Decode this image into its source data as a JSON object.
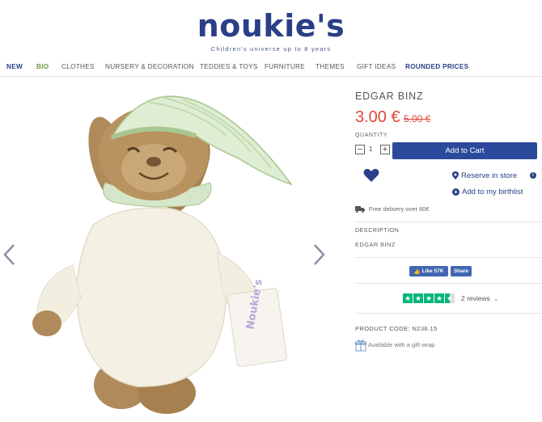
{
  "header": {
    "logo": "noukie's",
    "tagline": "Children's universe up to 8 years"
  },
  "nav": {
    "items": [
      "NEW",
      "BIO",
      "CLOTHES",
      "NURSERY & DECORATION",
      "TEDDIES & TOYS",
      "FURNITURE",
      "THEMES",
      "GIFT IDEAS",
      "ROUNDED PRICES"
    ]
  },
  "product": {
    "title": "EDGAR BINZ",
    "price": "3.00 €",
    "old_price": "5.00 €",
    "quantity_label": "QUANTITY",
    "quantity": "1",
    "add_to_cart": "Add to Cart",
    "reserve": "Reserve in store",
    "birthlist": "Add to my birthlist",
    "delivery": "Free delivery over 60€",
    "description_label": "DESCRIPTION",
    "description": "EDGAR BINZ",
    "reviews": "2 reviews",
    "rating_stars": 4.5,
    "product_code": "PRODUCT CODE: N236.15",
    "gift_wrap": "Available with a gift wrap",
    "tag_text": "Noukie's"
  },
  "social": {
    "like": "Like 57K",
    "share": "Share"
  },
  "colors": {
    "brand": "#2a3f87",
    "accent_green": "#6b9a3a",
    "price_red": "#e2473a",
    "cart_button": "#2c4a9c",
    "trustpilot": "#00b67a",
    "facebook": "#4267b2"
  }
}
